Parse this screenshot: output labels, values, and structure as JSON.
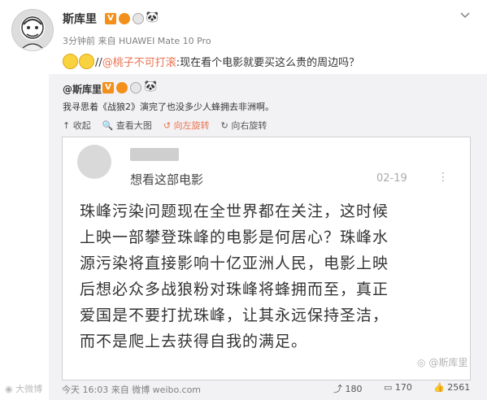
{
  "post": {
    "username": "斯库里",
    "meta": "3分钟前 来自 HUAWEI Mate 10 Pro",
    "text_prefix": "//",
    "mention": "@桃子不可打滚",
    "text_suffix": ":现在看个电影就要买这么贵的周边吗？"
  },
  "repost": {
    "author": "@斯库里",
    "text": "我寻思着《战狼2》演完了也没多少人蜂拥去非洲啊。",
    "actions": {
      "collapse": "收起",
      "view_large": "查看大图",
      "rotate_left": "向左旋转",
      "rotate_right": "向右旋转"
    }
  },
  "screenshot": {
    "subtitle": "想看这部电影",
    "date": "02-19",
    "body_lines": [
      "珠峰污染问题现在全世界都在关注，这时候",
      "上映一部攀登珠峰的电影是何居心？珠峰水",
      "源污染将直接影响十亿亚洲人民，电影上映",
      "后想必众多战狼粉对珠峰将蜂拥而至，真正",
      "爱国是不要打扰珠峰，让其永远保持圣洁，",
      "而不是爬上去获得自我的满足。"
    ],
    "watermark": "@斯库里"
  },
  "footer": {
    "source": "今天 16:03 来自 微博 weibo.com",
    "repost_count": "180",
    "comment_count": "170",
    "like_count": "2561",
    "bottom_watermark": "大微博"
  },
  "colors": {
    "accent": "#eb7350",
    "vip": "#f38f1b",
    "repost_bg": "#f2f2f5"
  }
}
